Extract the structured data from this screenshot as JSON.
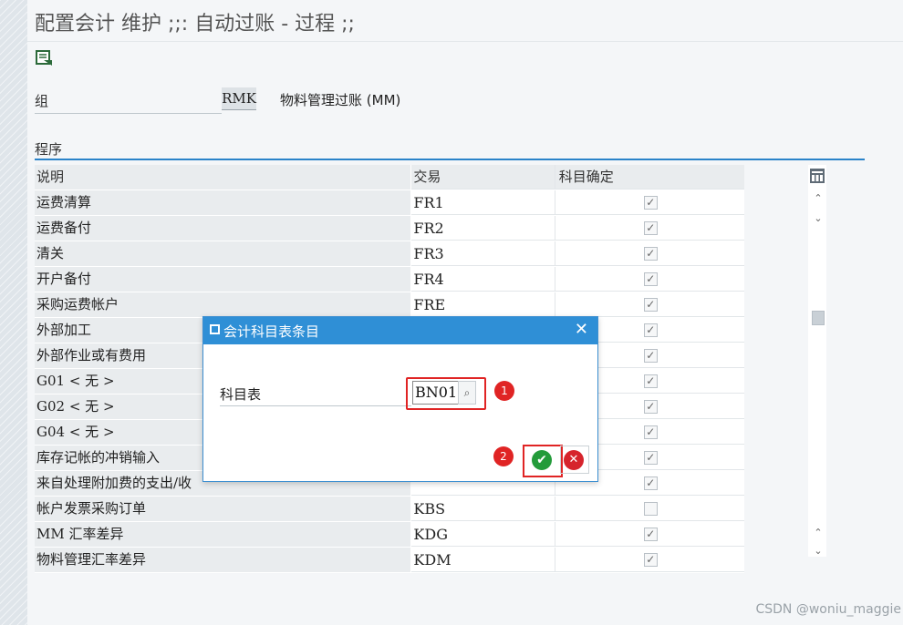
{
  "header": {
    "title": "配置会计 维护 ;;: 自动过账 - 过程 ;;"
  },
  "form": {
    "group_label": "组",
    "group_value": "RMK",
    "group_description": "物料管理过账 (MM)"
  },
  "section": {
    "title": "程序"
  },
  "table": {
    "columns": [
      "说明",
      "交易",
      "科目确定"
    ],
    "rows": [
      {
        "desc": "运费清算",
        "txn": "FR1",
        "checked": true
      },
      {
        "desc": "运费备付",
        "txn": "FR2",
        "checked": true
      },
      {
        "desc": "清关",
        "txn": "FR3",
        "checked": true
      },
      {
        "desc": "开户备付",
        "txn": "FR4",
        "checked": true
      },
      {
        "desc": "采购运费帐户",
        "txn": "FRE",
        "checked": true
      },
      {
        "desc": "外部加工",
        "txn": "",
        "checked": true
      },
      {
        "desc": "外部作业或有费用",
        "txn": "",
        "checked": true
      },
      {
        "desc": "G01 < 无 >",
        "txn": "",
        "checked": true
      },
      {
        "desc": "G02 < 无 >",
        "txn": "",
        "checked": true
      },
      {
        "desc": "G04 < 无 >",
        "txn": "",
        "checked": true
      },
      {
        "desc": "库存记帐的冲销输入",
        "txn": "",
        "checked": true
      },
      {
        "desc": "来自处理附加费的支出/收",
        "txn": "",
        "checked": true
      },
      {
        "desc": "帐户发票采购订单",
        "txn": "KBS",
        "checked": false
      },
      {
        "desc": "MM 汇率差异",
        "txn": "KDG",
        "checked": true
      },
      {
        "desc": "物料管理汇率差异",
        "txn": "KDM",
        "checked": true
      }
    ]
  },
  "dialog": {
    "title": "会计科目表条目",
    "field_label": "科目表",
    "field_value": "BN01",
    "badge1": "1",
    "badge2": "2"
  },
  "icons": {
    "close": "close-icon",
    "ok": "check-icon",
    "cancel": "cancel-icon"
  },
  "watermark": "CSDN @woniu_maggie"
}
